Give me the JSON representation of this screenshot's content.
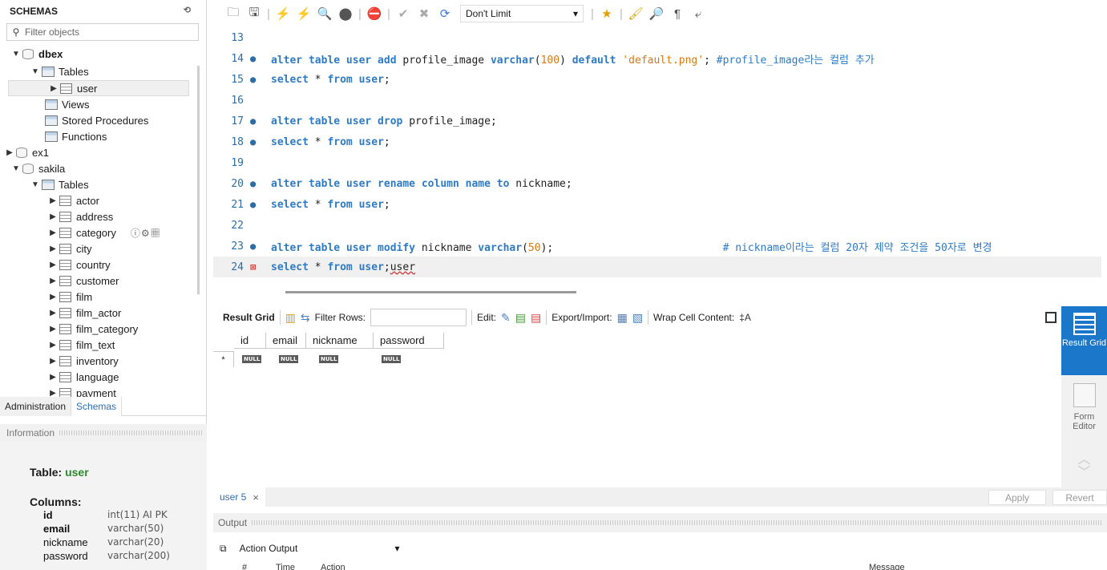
{
  "sidebar": {
    "title": "SCHEMAS",
    "filter_placeholder": "Filter objects",
    "tree": {
      "dbex": "dbex",
      "tables": "Tables",
      "user": "user",
      "views": "Views",
      "stored_procedures": "Stored Procedures",
      "functions": "Functions",
      "ex1": "ex1",
      "sakila": "sakila",
      "sakila_tables": "Tables",
      "sakila_items": [
        "actor",
        "address",
        "category",
        "city",
        "country",
        "customer",
        "film",
        "film_actor",
        "film_category",
        "film_text",
        "inventory",
        "language",
        "payment"
      ]
    },
    "tabs": [
      "Administration",
      "Schemas"
    ],
    "info": {
      "header": "Information",
      "table_label": "Table:",
      "table_name": "user",
      "columns_label": "Columns:",
      "columns": [
        {
          "name": "id",
          "type": "int(11) AI PK"
        },
        {
          "name": "email",
          "type": "varchar(50)"
        },
        {
          "name": "nickname",
          "type": "varchar(20)"
        },
        {
          "name": "password",
          "type": "varchar(200)"
        }
      ]
    }
  },
  "toolbar": {
    "limit": "Don't Limit"
  },
  "editor": {
    "line_numbers": [
      "13",
      "14",
      "15",
      "16",
      "17",
      "18",
      "19",
      "20",
      "21",
      "22",
      "23",
      "24"
    ],
    "lines": {
      "l14_comment": "#profile_image라는 컬럼 추가",
      "l23_comment": "# nickname이라는 컬럼 20자 제약 조건을 50자로 변경",
      "l24_tail": "user"
    }
  },
  "result": {
    "toolbar": {
      "result_grid": "Result Grid",
      "filter_rows": "Filter Rows:",
      "edit": "Edit:",
      "export_import": "Export/Import:",
      "wrap": "Wrap Cell Content:"
    },
    "columns": [
      "id",
      "email",
      "nickname",
      "password"
    ],
    "null_label": "NULL",
    "row_marker": "*"
  },
  "right_sidebar": {
    "result_grid": "Result Grid",
    "form_editor": "Form Editor"
  },
  "result_tabs": {
    "tab": "user 5",
    "apply": "Apply",
    "revert": "Revert"
  },
  "output": {
    "header": "Output",
    "selector": "Action Output",
    "columns": [
      "#",
      "Time",
      "Action",
      "Message"
    ]
  }
}
